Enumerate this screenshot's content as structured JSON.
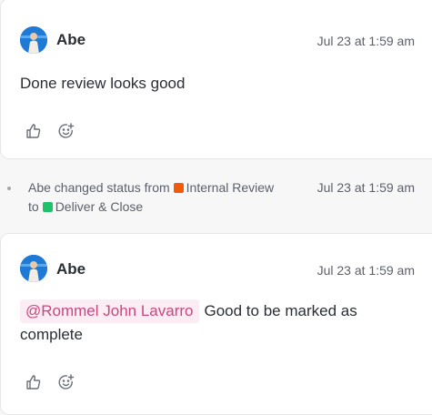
{
  "comments": [
    {
      "author": "Abe",
      "timestamp": "Jul 23 at 1:59 am",
      "text": "Done review looks good"
    },
    {
      "author": "Abe",
      "timestamp": "Jul 23 at 1:59 am",
      "mention": "@Rommel John Lavarro",
      "text": "Good to be marked as complete"
    }
  ],
  "activity": {
    "prefix": "Abe changed status from",
    "from_status": "Internal Review",
    "from_color": "#f25a0a",
    "connector": "to",
    "to_status": "Deliver & Close",
    "to_color": "#1fc16b",
    "timestamp": "Jul 23 at 1:59 am"
  },
  "icons": {
    "like": "thumbs-up-icon",
    "reaction": "add-reaction-icon"
  }
}
